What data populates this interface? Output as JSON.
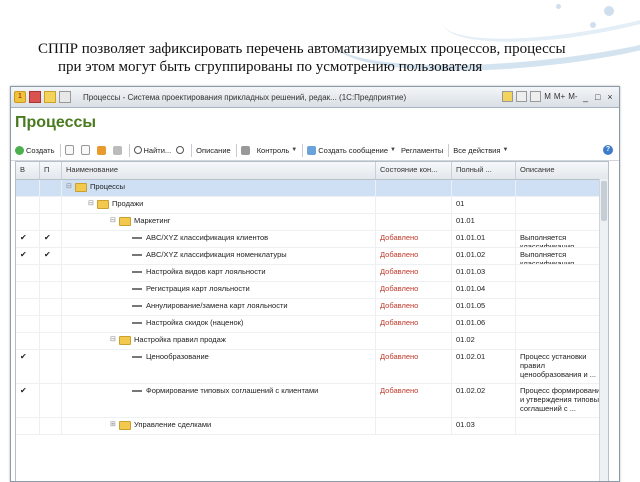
{
  "caption": {
    "line1": "СППР позволяет зафиксировать перечень автоматизируемых процессов, процессы",
    "line2": "при этом могут быть сгруппированы по усмотрению пользователя"
  },
  "window": {
    "title": "Процессы - Система проектирования прикладных решений, редак... (1С:Предприятие)",
    "right_labels": [
      "M",
      "M+",
      "M-"
    ],
    "controls": [
      "_",
      "□",
      "×"
    ]
  },
  "form": {
    "title": "Процессы",
    "toolbar": {
      "create": "Создать",
      "find": "Найти...",
      "description": "Описание",
      "control": "Контроль",
      "create_message": "Создать сообщение",
      "regulations": "Регламенты",
      "all_actions": "Все действия",
      "help": "?"
    }
  },
  "grid": {
    "columns": [
      "В",
      "П",
      "Наименование",
      "Состояние кон...",
      "Полный ...",
      "Описание"
    ],
    "rows": [
      {
        "v": "",
        "p": "",
        "indent": 0,
        "kind": "folder",
        "name": "Процессы",
        "state": "",
        "code": "",
        "desc": "",
        "selected": true,
        "expand": "⊟"
      },
      {
        "v": "",
        "p": "",
        "indent": 1,
        "kind": "folder",
        "name": "Продажи",
        "state": "",
        "code": "01",
        "desc": "",
        "expand": "⊟"
      },
      {
        "v": "",
        "p": "",
        "indent": 2,
        "kind": "folder",
        "name": "Маркетинг",
        "state": "",
        "code": "01.01",
        "desc": "",
        "expand": "⊟"
      },
      {
        "v": "✔",
        "p": "✔",
        "indent": 3,
        "kind": "item",
        "name": "ABC/XYZ классификация клиентов",
        "state": "Добавлено",
        "code": "01.01.01",
        "desc": "Выполняется классификация клиентов в ..."
      },
      {
        "v": "✔",
        "p": "✔",
        "indent": 3,
        "kind": "item",
        "name": "ABC/XYZ классификация номенклатуры",
        "state": "Добавлено",
        "code": "01.01.02",
        "desc": "Выполняется классификация номенклатуры в ..."
      },
      {
        "v": "",
        "p": "",
        "indent": 3,
        "kind": "item",
        "name": "Настройка видов карт лояльности",
        "state": "Добавлено",
        "code": "01.01.03",
        "desc": ""
      },
      {
        "v": "",
        "p": "",
        "indent": 3,
        "kind": "item",
        "name": "Регистрация карт лояльности",
        "state": "Добавлено",
        "code": "01.01.04",
        "desc": ""
      },
      {
        "v": "",
        "p": "",
        "indent": 3,
        "kind": "item",
        "name": "Аннулирование/замена карт лояльности",
        "state": "Добавлено",
        "code": "01.01.05",
        "desc": ""
      },
      {
        "v": "",
        "p": "",
        "indent": 3,
        "kind": "item",
        "name": "Настройка скидок (наценок)",
        "state": "Добавлено",
        "code": "01.01.06",
        "desc": ""
      },
      {
        "v": "",
        "p": "",
        "indent": 2,
        "kind": "folder",
        "name": "Настройка правил продаж",
        "state": "",
        "code": "01.02",
        "desc": "",
        "expand": "⊟"
      },
      {
        "v": "✔",
        "p": "",
        "indent": 3,
        "kind": "item",
        "name": "Ценообразование",
        "state": "Добавлено",
        "code": "01.02.01",
        "desc": "Процесс установки правил ценообразования и ..."
      },
      {
        "v": "✔",
        "p": "",
        "indent": 3,
        "kind": "item",
        "name": "Формирование типовых соглашений с клиентами",
        "state": "Добавлено",
        "code": "01.02.02",
        "desc": "Процесс формирования и утверждения типовых соглашений с ..."
      },
      {
        "v": "",
        "p": "",
        "indent": 2,
        "kind": "folder",
        "name": "Управление сделками",
        "state": "",
        "code": "01.03",
        "desc": "",
        "expand": "⊞"
      }
    ]
  },
  "colors": {
    "title_green": "#4a7a1e",
    "state_red": "#c0392b",
    "selection": "#cfe0f5"
  }
}
